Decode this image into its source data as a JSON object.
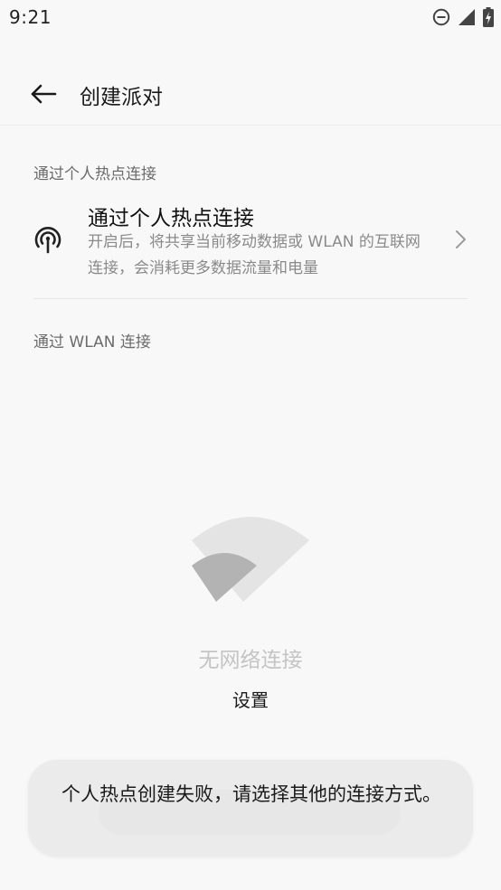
{
  "status_bar": {
    "time": "9:21",
    "icons": [
      "do-not-disturb-icon",
      "cellular-signal-icon",
      "battery-charging-icon"
    ]
  },
  "app_bar": {
    "back_icon": "arrow-left-icon",
    "title": "创建派对"
  },
  "hotspot_section": {
    "header": "通过个人热点连接",
    "item": {
      "icon": "hotspot-icon",
      "title": "通过个人热点连接",
      "description": "开启后，将共享当前移动数据或 WLAN 的互联网连接，会消耗更多数据流量和电量",
      "chevron_icon": "chevron-right-icon"
    }
  },
  "wlan_section": {
    "header": "通过 WLAN 连接",
    "empty_state": {
      "illustration": "wifi-off-icon",
      "text": "无网络连接",
      "settings_label": "设置"
    }
  },
  "toast": {
    "message": "个人热点创建失败，请选择其他的连接方式。"
  },
  "colors": {
    "background": "#f8f8f8",
    "secondary_text": "#8a8a8a",
    "disabled_text": "#c4c4c4",
    "toast_bg": "#ebebeb"
  }
}
